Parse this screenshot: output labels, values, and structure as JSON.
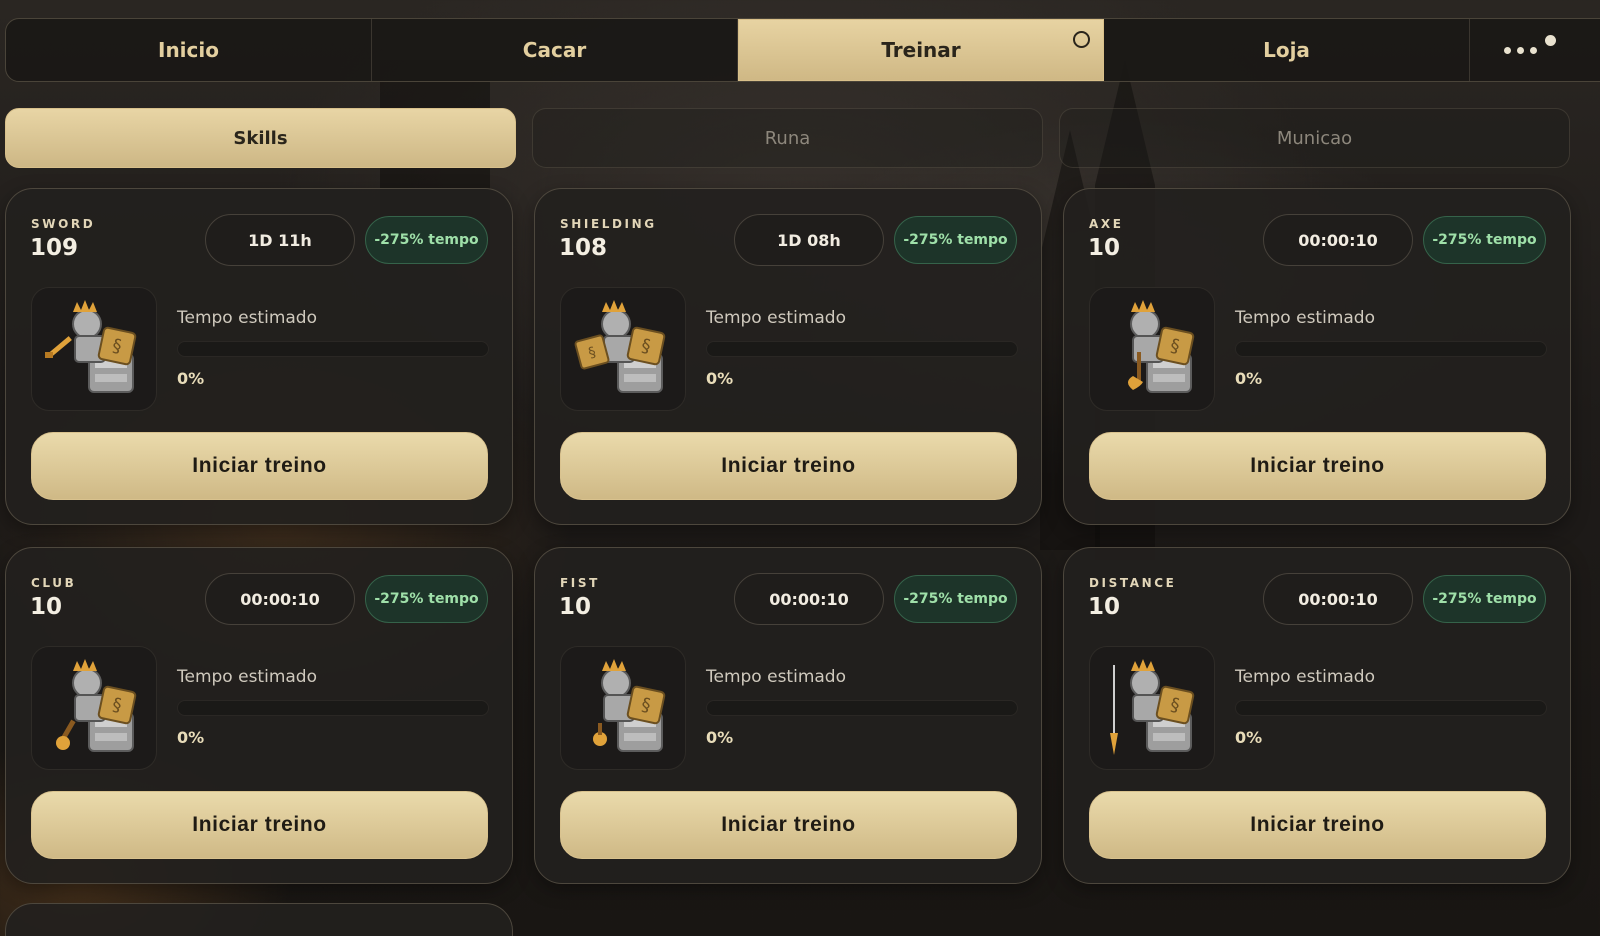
{
  "nav": {
    "tabs": [
      {
        "label": "Inicio"
      },
      {
        "label": "Cacar"
      },
      {
        "label": "Treinar"
      },
      {
        "label": "Loja"
      }
    ]
  },
  "subtabs": [
    {
      "label": "Skills"
    },
    {
      "label": "Runa"
    },
    {
      "label": "Municao"
    }
  ],
  "cards": [
    {
      "skill": "SWORD",
      "level": "109",
      "time": "1D 11h",
      "bonus": "-275% tempo",
      "estimate_label": "Tempo estimado",
      "progress": 0,
      "progress_label": "0%",
      "button": "Iniciar treino",
      "weapon": "sword"
    },
    {
      "skill": "SHIELDING",
      "level": "108",
      "time": "1D 08h",
      "bonus": "-275% tempo",
      "estimate_label": "Tempo estimado",
      "progress": 0,
      "progress_label": "0%",
      "button": "Iniciar treino",
      "weapon": "shield"
    },
    {
      "skill": "AXE",
      "level": "10",
      "time": "00:00:10",
      "bonus": "-275% tempo",
      "estimate_label": "Tempo estimado",
      "progress": 0,
      "progress_label": "0%",
      "button": "Iniciar treino",
      "weapon": "axe"
    },
    {
      "skill": "CLUB",
      "level": "10",
      "time": "00:00:10",
      "bonus": "-275% tempo",
      "estimate_label": "Tempo estimado",
      "progress": 0,
      "progress_label": "0%",
      "button": "Iniciar treino",
      "weapon": "club"
    },
    {
      "skill": "FIST",
      "level": "10",
      "time": "00:00:10",
      "bonus": "-275% tempo",
      "estimate_label": "Tempo estimado",
      "progress": 0,
      "progress_label": "0%",
      "button": "Iniciar treino",
      "weapon": "fist"
    },
    {
      "skill": "DISTANCE",
      "level": "10",
      "time": "00:00:10",
      "bonus": "-275% tempo",
      "estimate_label": "Tempo estimado",
      "progress": 0,
      "progress_label": "0%",
      "button": "Iniciar treino",
      "weapon": "spear"
    }
  ],
  "colors": {
    "accent": "#d9c48f",
    "bonus_text": "#9fe0a9",
    "bonus_bg": "#1d3429"
  }
}
